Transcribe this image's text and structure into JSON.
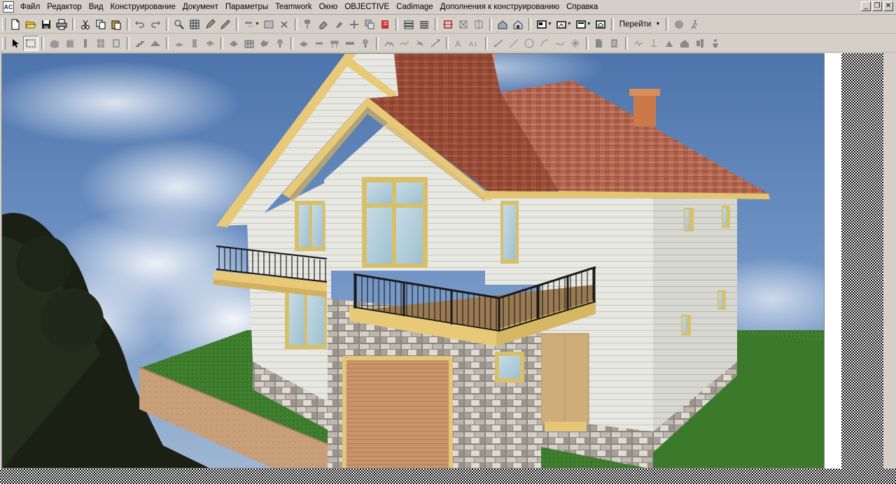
{
  "app": {
    "icon_text": "AC"
  },
  "menu": [
    "Файл",
    "Редактор",
    "Вид",
    "Конструирование",
    "Документ",
    "Параметры",
    "Teamwork",
    "Окно",
    "OBJECTIVE",
    "Cadimage",
    "Дополнения к конструированию",
    "Справка"
  ],
  "window_controls": {
    "minimize": "_",
    "restore": "❐",
    "close": "✕"
  },
  "toolbar1": {
    "buttons": [
      "new-file-icon",
      "open-folder-icon",
      "save-icon",
      "print-icon",
      "cut-icon",
      "copy-icon",
      "paste-icon",
      "undo-icon",
      "redo-icon",
      "find-select-icon",
      "grid-icon",
      "pencil-icon",
      "pen-icon",
      "trim-icon",
      "table-icon",
      "x-icon",
      "brush-icon",
      "eraser-icon",
      "drop-icon",
      "snap-icon",
      "layers-icon",
      "book-icon",
      "stack-icon",
      "layer-list-icon",
      "section-icon",
      "elevation-icon",
      "split-icon",
      "house-3d-icon",
      "house-plan-icon",
      "view-window-icon",
      "camera-icon",
      "layout-icon",
      "home-icon",
      "brain-icon",
      "walk-icon"
    ],
    "goto_label": "Перейти"
  },
  "toolbar2": {
    "buttons": [
      "arrow-select-icon",
      "marquee-select-icon",
      "wall-icon",
      "column-icon",
      "beam-icon",
      "door-icon",
      "window-icon",
      "stair-icon",
      "roof-icon",
      "slab-icon",
      "mesh-icon",
      "shell-icon",
      "morph-icon",
      "curtain-wall-icon",
      "object-icon",
      "lamp-icon",
      "zone-icon",
      "dimension-icon",
      "level-icon",
      "text-icon",
      "label-icon",
      "fill-icon",
      "line-icon",
      "circle-icon",
      "arc-icon",
      "spline-icon",
      "hotspot-icon",
      "figure-icon",
      "drawing-icon",
      "section-marker-icon",
      "elevation-marker-icon",
      "interior-icon",
      "worksheet-icon",
      "detail-icon",
      "change-icon"
    ]
  },
  "colors": {
    "chrome": "#d4d0c8",
    "sky": "#5b82b8",
    "roof": "#9a4a34",
    "grass": "#3d7a2c",
    "siding": "#e6e6e0",
    "trim": "#e3c66f"
  }
}
